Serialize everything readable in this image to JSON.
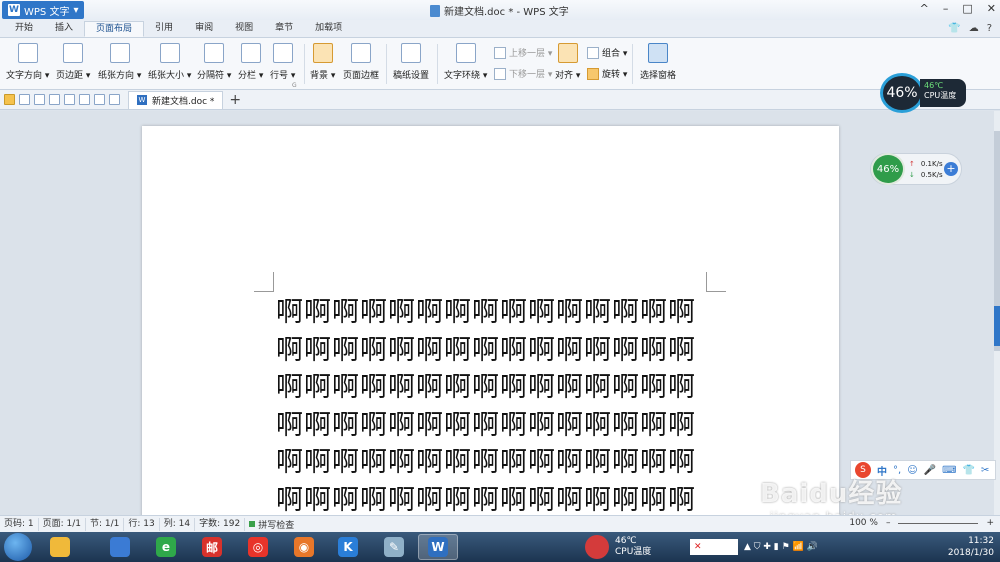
{
  "app": {
    "menu_label": "WPS 文字",
    "logo_letter": "W",
    "window_title": "新建文档.doc * - WPS 文字"
  },
  "window_controls": {
    "help": "^",
    "minimize": "–",
    "maximize": "□",
    "close": "✕"
  },
  "ribbon_tabs": [
    "开始",
    "插入",
    "页面布局",
    "引用",
    "审阅",
    "视图",
    "章节",
    "加载项"
  ],
  "active_tab": "页面布局",
  "tab_icons": {
    "shirt": "👕",
    "cloud": "☁",
    "help": "?"
  },
  "ribbon": {
    "text_direction": "文字方向 ▾",
    "margins": "页边距 ▾",
    "orientation": "纸张方向 ▾",
    "paper_size": "纸张大小 ▾",
    "breaks": "分隔符 ▾",
    "columns": "分栏 ▾",
    "line_numbers": "行号 ▾",
    "background": "背景 ▾",
    "page_border": "页面边框",
    "manuscript": "稿纸设置",
    "wrap_text": "文字环绕 ▾",
    "bring_forward": "上移一层 ▾",
    "send_backward": "下移一层 ▾",
    "align": "对齐 ▾",
    "group": "组合 ▾",
    "rotate": "旋转 ▾",
    "selection_pane": "选择窗格",
    "group_marker": "G"
  },
  "doc_tab": {
    "label": "新建文档.doc *",
    "icon_letter": "W",
    "new_tab": "+"
  },
  "document": {
    "content": "啊啊啊啊啊啊啊啊啊啊啊啊啊啊啊啊啊啊啊啊啊啊啊啊啊啊啊啊啊啊啊啊啊啊啊啊啊啊啊啊啊啊啊啊啊啊啊啊啊啊啊啊啊啊啊啊啊啊啊啊啊啊啊啊啊啊啊啊啊啊啊啊啊啊啊啊啊啊啊啊啊啊啊啊啊啊啊啊啊啊"
  },
  "cpu_widget": {
    "percent": "46%",
    "temp": "46℃",
    "label": "CPU温度"
  },
  "net_widget": {
    "percent": "46%",
    "up": "0.1K/s",
    "down": "0.5K/s",
    "up_arrow": "↑",
    "down_arrow": "↓",
    "plus": "+"
  },
  "ime": {
    "logo": "S",
    "lang": "中",
    "punct": "°,",
    "emoji": "☺",
    "mic": "🎤",
    "keyboard": "⌨",
    "skin": "👕",
    "tools": "✂"
  },
  "watermark": {
    "main": "Baidu经验",
    "sub": "jingyan.baidu.com"
  },
  "statusbar": {
    "page_no": "页码: 1",
    "pages": "页面: 1/1",
    "section": "节: 1/1",
    "row": "行: 13",
    "col": "列: 14",
    "words": "字数: 192",
    "spell": "拼写检查",
    "zoom": "100 %",
    "zoom_minus": "–",
    "zoom_plus": "+"
  },
  "taskbar": {
    "apps": [
      {
        "glyph": "",
        "color": "#3b7bd4"
      },
      {
        "glyph": "",
        "color": "#f0b93a"
      },
      {
        "glyph": "e",
        "color": "#2fa84a"
      },
      {
        "glyph": "邮",
        "color": "#d8322c"
      },
      {
        "glyph": "◎",
        "color": "#e8342a"
      },
      {
        "glyph": "◉",
        "color": "#e8772a"
      },
      {
        "glyph": "K",
        "color": "#2a7ed8"
      },
      {
        "glyph": "✎",
        "color": "#8fb0c8"
      },
      {
        "glyph": "W",
        "color": "#2f6fc0"
      }
    ],
    "cpu_temp": "46℃",
    "cpu_label": "CPU温度",
    "tray_box": "✕",
    "tray_icons": "▲ ⛉ ✚ ▮ ⚑ 📶 🔊",
    "time": "11:32",
    "date": "2018/1/30"
  },
  "colors": {
    "accent": "#2f76c8",
    "page": "#ffffff",
    "workspace": "#dbe2ea"
  }
}
